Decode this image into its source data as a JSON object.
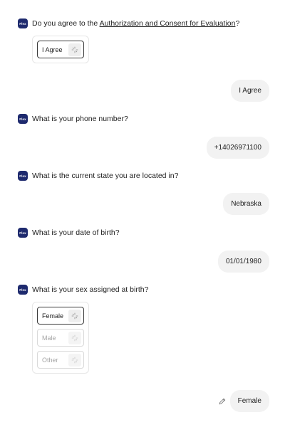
{
  "avatar_label": "Flex",
  "messages": {
    "consent": {
      "question_prefix": "Do you agree to the ",
      "question_link": "Authorization and Consent for Evaluation",
      "question_suffix": "?",
      "options": [
        "I Agree"
      ],
      "answer": "I Agree"
    },
    "phone": {
      "question": "What is your phone number?",
      "answer": "+14026971100"
    },
    "state": {
      "question": "What is the current state you are located in?",
      "answer": "Nebraska"
    },
    "dob": {
      "question": "What is your date of birth?",
      "answer": "01/01/1980"
    },
    "sex": {
      "question": "What is your sex assigned at birth?",
      "options": [
        "Female",
        "Male",
        "Other"
      ],
      "answer": "Female"
    }
  },
  "icons": {
    "avatar": "flex-logo-icon",
    "option_action": "sparkle-icon",
    "edit": "pencil-icon"
  },
  "colors": {
    "avatar_bg": "#1e2a6e",
    "bubble_bg": "#f2f2f2",
    "selected_border": "#3a3a3a",
    "disabled_text": "#a6a6a6"
  }
}
